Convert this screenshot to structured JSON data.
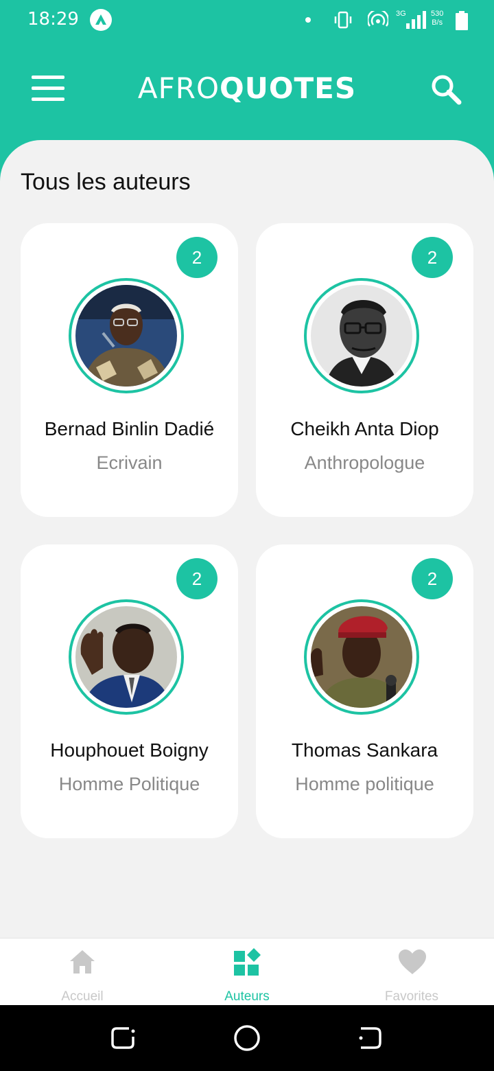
{
  "status_bar": {
    "time": "18:29",
    "network": "3G",
    "speed_value": "530",
    "speed_unit": "B/s"
  },
  "app": {
    "brand_part1": "AFRO",
    "brand_part2": "QUOTES"
  },
  "section": {
    "title": "Tous les auteurs"
  },
  "authors": [
    {
      "name": "Bernad Binlin Dadié",
      "role": "Ecrivain",
      "count": "2"
    },
    {
      "name": "Cheikh Anta Diop",
      "role": "Anthropologue",
      "count": "2"
    },
    {
      "name": "Houphouet Boigny",
      "role": "Homme Politique",
      "count": "2"
    },
    {
      "name": "Thomas Sankara",
      "role": "Homme politique",
      "count": "2"
    }
  ],
  "bottom_nav": [
    {
      "label": "Accueil",
      "icon": "home-icon",
      "active": false
    },
    {
      "label": "Auteurs",
      "icon": "authors-grid-icon",
      "active": true
    },
    {
      "label": "Favorites",
      "icon": "heart-icon",
      "active": false
    }
  ],
  "colors": {
    "accent": "#1dc3a3",
    "background": "#f2f2f2",
    "inactive": "#c8c8c8"
  }
}
